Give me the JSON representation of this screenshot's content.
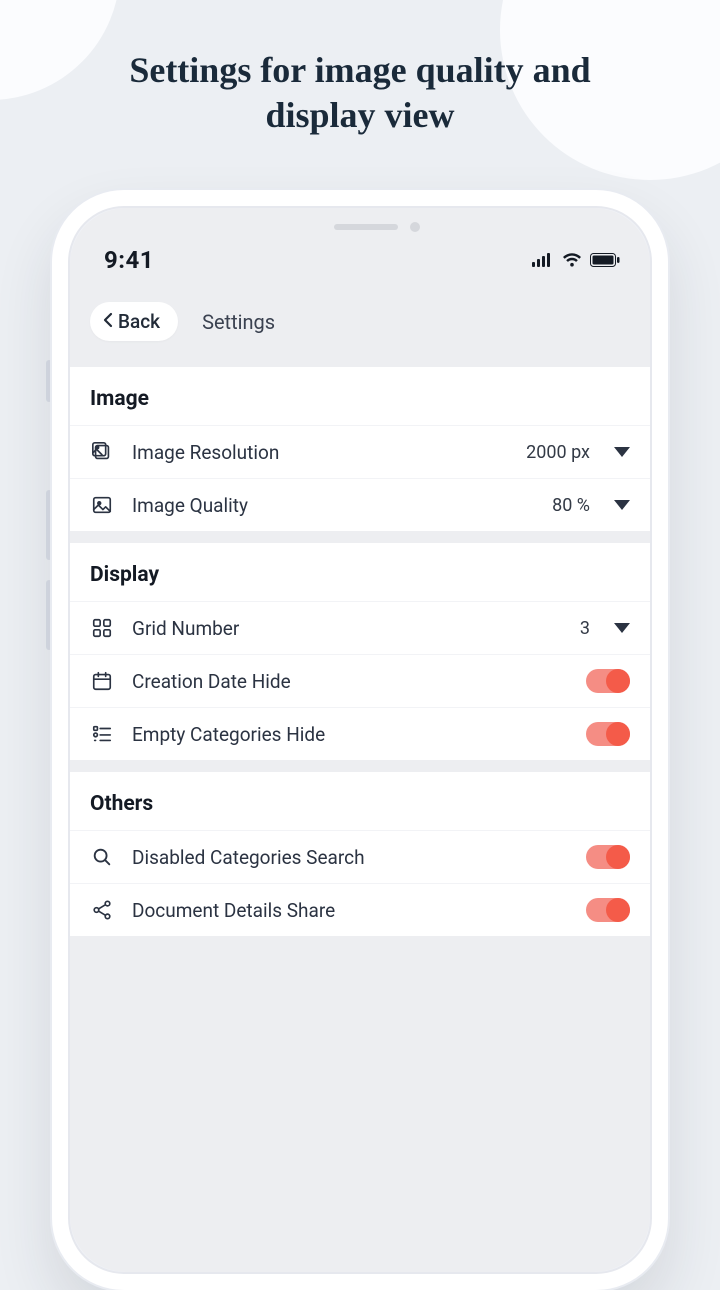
{
  "hero": {
    "line1": "Settings for image quality and",
    "line2": "display view"
  },
  "status": {
    "time": "9:41"
  },
  "nav": {
    "back": "Back",
    "title": "Settings"
  },
  "sections": {
    "image": {
      "title": "Image",
      "resolution": {
        "label": "Image Resolution",
        "value": "2000 px"
      },
      "quality": {
        "label": "Image Quality",
        "value": "80 %"
      }
    },
    "display": {
      "title": "Display",
      "grid": {
        "label": "Grid Number",
        "value": "3"
      },
      "dateHide": {
        "label": "Creation Date Hide",
        "on": true
      },
      "emptyHide": {
        "label": "Empty Categories Hide",
        "on": true
      }
    },
    "others": {
      "title": "Others",
      "disabledSearch": {
        "label": "Disabled Categories Search",
        "on": true
      },
      "detailsShare": {
        "label": "Document Details Share",
        "on": true
      }
    }
  }
}
